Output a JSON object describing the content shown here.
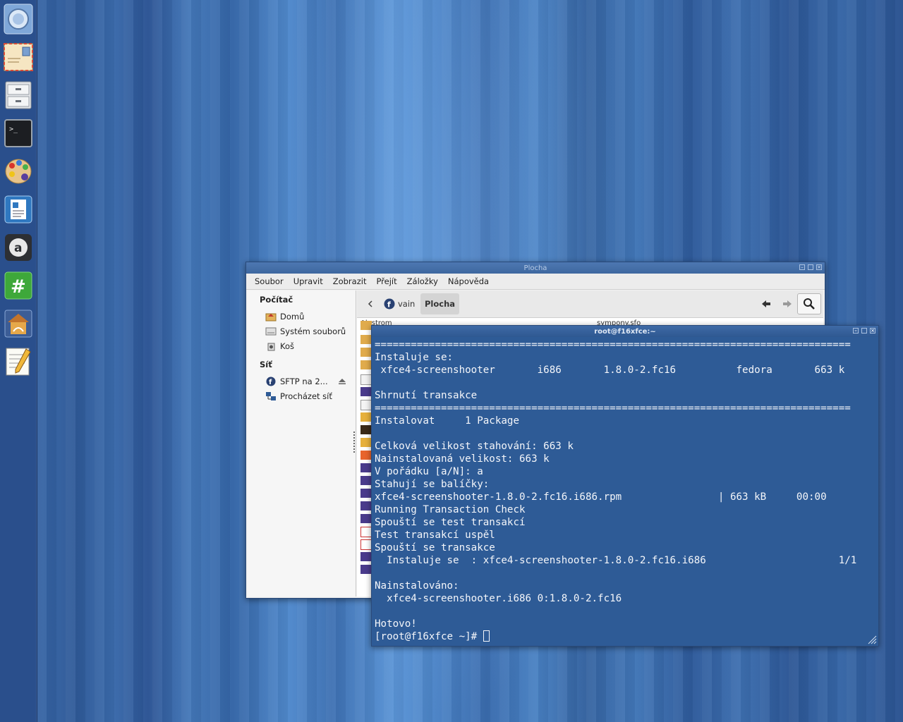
{
  "dock": {
    "items": [
      {
        "name": "web-browser"
      },
      {
        "name": "mail-client"
      },
      {
        "name": "file-cabinet"
      },
      {
        "name": "terminal",
        "glyph": ">_"
      },
      {
        "name": "paint"
      },
      {
        "name": "text-document"
      },
      {
        "name": "abiword",
        "glyph": "a"
      },
      {
        "name": "hashtag-chat",
        "glyph": "#"
      },
      {
        "name": "app-launcher"
      },
      {
        "name": "text-editor"
      }
    ]
  },
  "file_manager": {
    "title": "Plocha",
    "menu": [
      "Soubor",
      "Upravit",
      "Zobrazit",
      "Přejít",
      "Záložky",
      "Nápověda"
    ],
    "sidebar": {
      "section_computer": "Počítač",
      "computer_items": [
        "Domů",
        "Systém souborů",
        "Koš"
      ],
      "section_network": "Síť",
      "network_items": [
        "SFTP na 2...",
        "Procházet síť"
      ]
    },
    "breadcrumbs": [
      "vain",
      "Plocha"
    ],
    "partial_items": [
      "Alastrom",
      "sympony.sfo"
    ]
  },
  "terminal": {
    "title": "root@f16xfce:~",
    "lines": [
      "===============================================================================",
      "Instaluje se:",
      " xfce4-screenshooter       i686       1.8.0-2.fc16          fedora       663 k",
      "",
      "Shrnutí transakce",
      "===============================================================================",
      "Instalovat     1 Package",
      "",
      "Celková velikost stahování: 663 k",
      "Nainstalovaná velikost: 663 k",
      "V pořádku [a/N]: a",
      "Stahují se balíčky:",
      "xfce4-screenshooter-1.8.0-2.fc16.i686.rpm                | 663 kB     00:00",
      "Running Transaction Check",
      "Spouští se test transakcí",
      "Test transakcí uspěl",
      "Spouští se transakce",
      "  Instaluje se  : xfce4-screenshooter-1.8.0-2.fc16.i686                      1/1",
      "",
      "Nainstalováno:",
      "  xfce4-screenshooter.i686 0:1.8.0-2.fc16",
      "",
      "Hotovo!"
    ],
    "prompt": "[root@f16xfce ~]# "
  }
}
